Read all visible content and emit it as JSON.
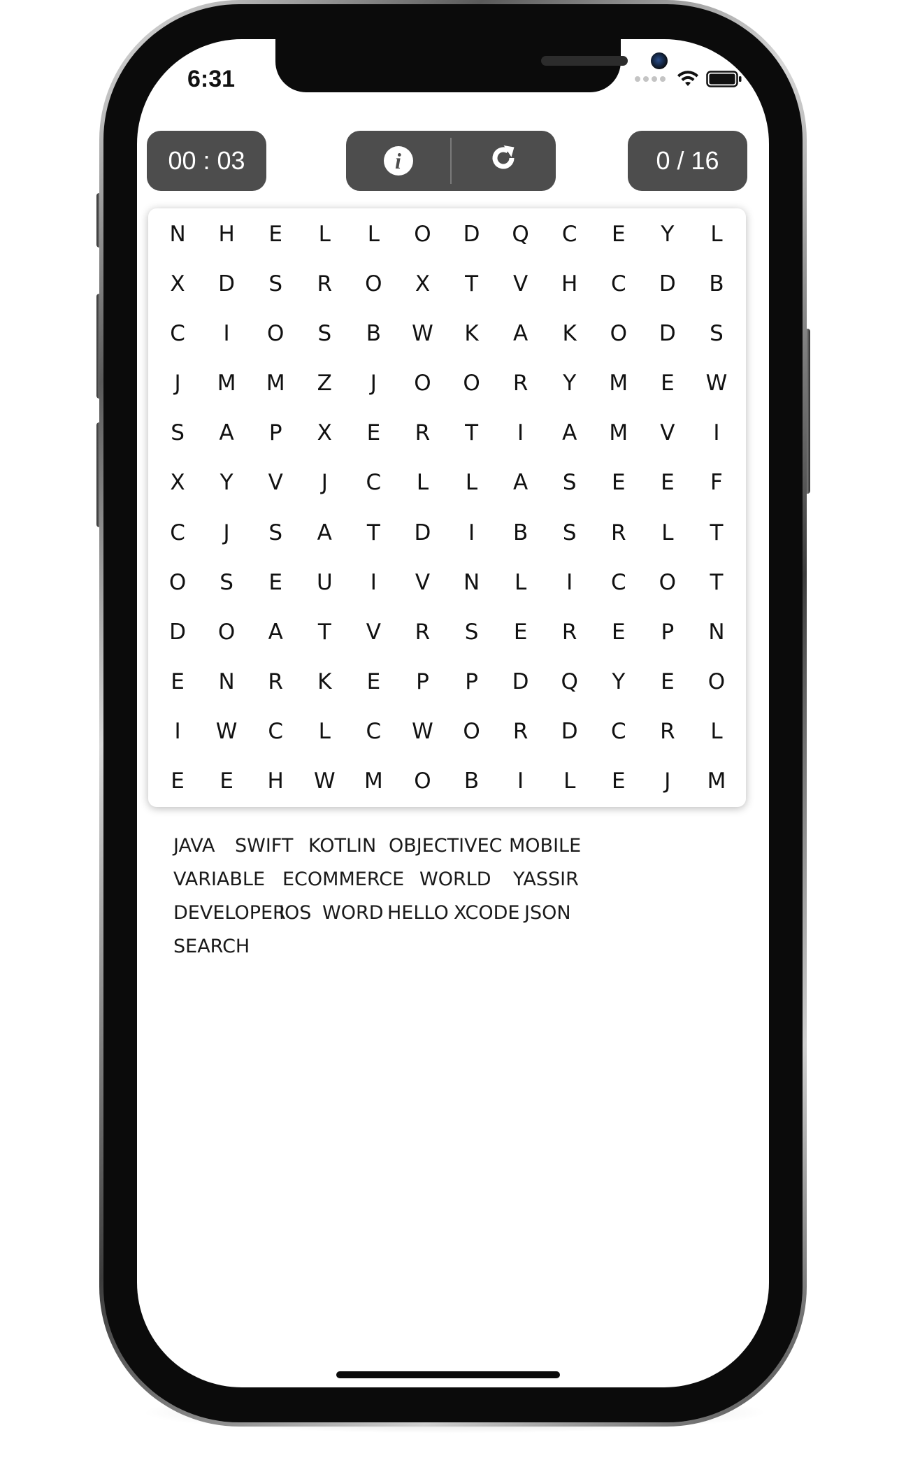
{
  "status_bar": {
    "time": "6:31"
  },
  "toolbar": {
    "timer": "00 : 03",
    "score": "0 / 16",
    "info_icon": "info-icon",
    "refresh_icon": "refresh-icon"
  },
  "grid": {
    "rows": [
      [
        "N",
        "H",
        "E",
        "L",
        "L",
        "O",
        "D",
        "Q",
        "C",
        "E",
        "Y",
        "L"
      ],
      [
        "X",
        "D",
        "S",
        "R",
        "O",
        "X",
        "T",
        "V",
        "H",
        "C",
        "D",
        "B"
      ],
      [
        "C",
        "I",
        "O",
        "S",
        "B",
        "W",
        "K",
        "A",
        "K",
        "O",
        "D",
        "S"
      ],
      [
        "J",
        "M",
        "M",
        "Z",
        "J",
        "O",
        "O",
        "R",
        "Y",
        "M",
        "E",
        "W"
      ],
      [
        "S",
        "A",
        "P",
        "X",
        "E",
        "R",
        "T",
        "I",
        "A",
        "M",
        "V",
        "I"
      ],
      [
        "X",
        "Y",
        "V",
        "J",
        "C",
        "L",
        "L",
        "A",
        "S",
        "E",
        "E",
        "F"
      ],
      [
        "C",
        "J",
        "S",
        "A",
        "T",
        "D",
        "I",
        "B",
        "S",
        "R",
        "L",
        "T"
      ],
      [
        "O",
        "S",
        "E",
        "U",
        "I",
        "V",
        "N",
        "L",
        "I",
        "C",
        "O",
        "T"
      ],
      [
        "D",
        "O",
        "A",
        "T",
        "V",
        "R",
        "S",
        "E",
        "R",
        "E",
        "P",
        "N"
      ],
      [
        "E",
        "N",
        "R",
        "K",
        "E",
        "P",
        "P",
        "D",
        "Q",
        "Y",
        "E",
        "O"
      ],
      [
        "I",
        "W",
        "C",
        "L",
        "C",
        "W",
        "O",
        "R",
        "D",
        "C",
        "R",
        "L"
      ],
      [
        "E",
        "E",
        "H",
        "W",
        "M",
        "O",
        "B",
        "I",
        "L",
        "E",
        "J",
        "M"
      ]
    ]
  },
  "words": [
    "JAVA",
    "SWIFT",
    "KOTLIN",
    "OBJECTIVEC",
    "MOBILE",
    "VARIABLE",
    "ECOMMERCE",
    "WORLD",
    "YASSIR",
    "DEVELOPER",
    "IOS",
    "WORD",
    "HELLO",
    "XCODE",
    "JSON",
    "SEARCH"
  ],
  "colors": {
    "pill_background": "#4d4d4d",
    "pill_text": "#ffffff",
    "grid_text": "#111111",
    "screen_background": "#ffffff"
  }
}
